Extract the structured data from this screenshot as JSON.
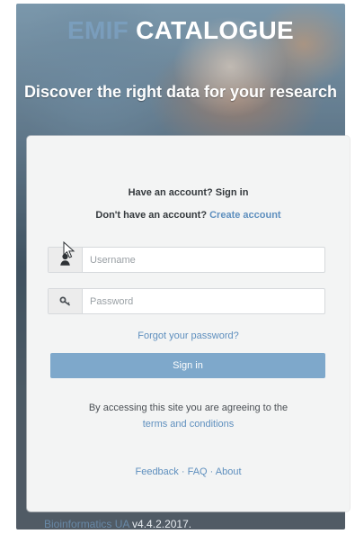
{
  "brand": {
    "prefix": "EMIF",
    "title": "CATALOGUE"
  },
  "hero": {
    "tagline": "Discover the right data for your research"
  },
  "login_card": {
    "have_account_text": "Have an account? Sign in",
    "no_account_text": "Don't have an account?",
    "create_account_link": "Create account",
    "username": {
      "placeholder": "Username",
      "value": ""
    },
    "password": {
      "placeholder": "Password",
      "value": ""
    },
    "forgot_password_link": "Forgot your password?",
    "sign_in_button": "Sign in",
    "terms_text": "By accessing this site you are agreeing to the",
    "terms_link": "terms and conditions",
    "footer_links": {
      "feedback": "Feedback",
      "faq": "FAQ",
      "about": "About",
      "separator": " · "
    }
  },
  "footer": {
    "organization": "Bioinformatics UA",
    "version": "v4.4.2.2017."
  },
  "colors": {
    "accent": "#7ea8cb",
    "link": "#5e8fbe",
    "card_bg": "#f3f4f4"
  },
  "icons": {
    "username": "user-icon",
    "password": "key-icon",
    "cursor": "mouse-cursor-icon"
  }
}
